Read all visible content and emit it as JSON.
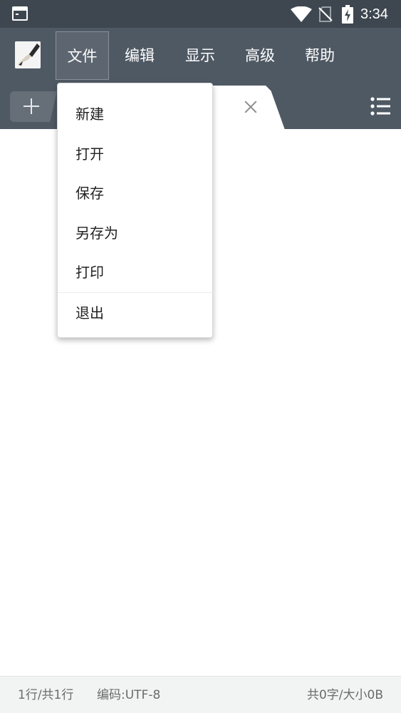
{
  "status_bar": {
    "time": "3:34",
    "icons": [
      "terminal-icon",
      "wifi-icon",
      "no-sim-icon",
      "battery-charging-icon"
    ]
  },
  "menu_bar": {
    "app_icon": "notepad-pen-icon",
    "items": [
      {
        "label": "文件",
        "active": true
      },
      {
        "label": "编辑"
      },
      {
        "label": "显示"
      },
      {
        "label": "高级"
      },
      {
        "label": "帮助"
      }
    ]
  },
  "tabs": {
    "new_tab_icon": "plus-icon",
    "close_icon": "close-icon",
    "list_icon": "list-icon"
  },
  "file_menu": {
    "items": [
      "新建",
      "打开",
      "保存",
      "另存为",
      "打印",
      "退出"
    ]
  },
  "footer": {
    "lines": "1行/共1行",
    "encoding": "编码:UTF-8",
    "size": "共0字/大小0B"
  },
  "colors": {
    "status_bar": "#3e4750",
    "toolbar": "#4f5964",
    "menu_active": "#5d6670",
    "footer_bg": "#f2f3f3"
  }
}
